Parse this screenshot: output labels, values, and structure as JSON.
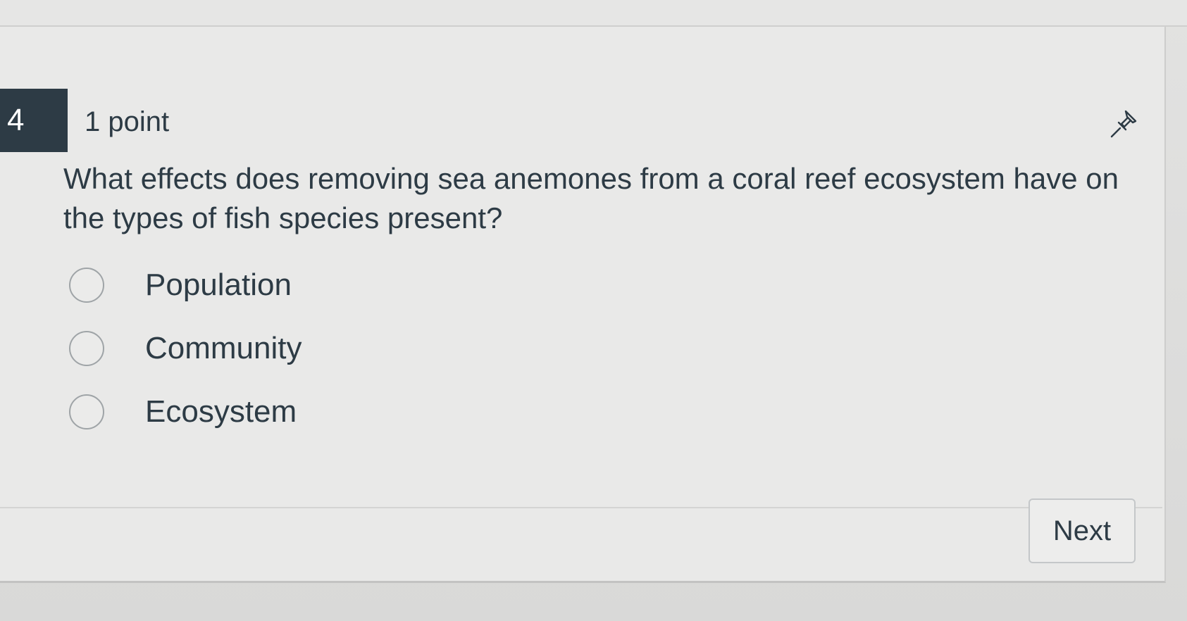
{
  "question": {
    "number": "4",
    "points": "1 point",
    "text": "What effects does removing sea anemones from a coral reef ecosystem have on the types of fish species present?",
    "options": [
      {
        "label": "Population"
      },
      {
        "label": "Community"
      },
      {
        "label": "Ecosystem"
      }
    ]
  },
  "controls": {
    "pin_icon": "pin-icon",
    "next_label": "Next"
  },
  "colors": {
    "number_badge_bg": "#2d3b45",
    "text": "#2d3b45"
  }
}
